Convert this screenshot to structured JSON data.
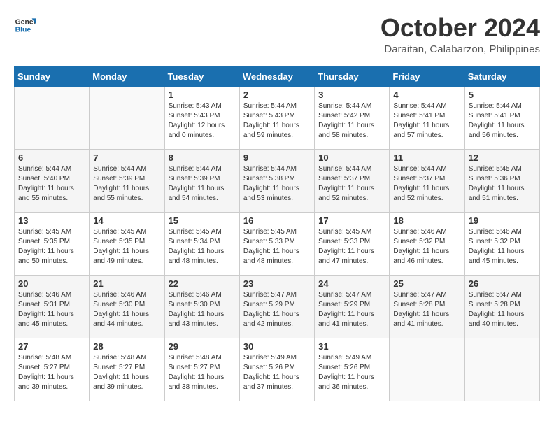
{
  "header": {
    "logo_line1": "General",
    "logo_line2": "Blue",
    "month_title": "October 2024",
    "location": "Daraitan, Calabarzon, Philippines"
  },
  "days_of_week": [
    "Sunday",
    "Monday",
    "Tuesday",
    "Wednesday",
    "Thursday",
    "Friday",
    "Saturday"
  ],
  "weeks": [
    [
      {
        "day": "",
        "info": ""
      },
      {
        "day": "",
        "info": ""
      },
      {
        "day": "1",
        "info": "Sunrise: 5:43 AM\nSunset: 5:43 PM\nDaylight: 12 hours\nand 0 minutes."
      },
      {
        "day": "2",
        "info": "Sunrise: 5:44 AM\nSunset: 5:43 PM\nDaylight: 11 hours\nand 59 minutes."
      },
      {
        "day": "3",
        "info": "Sunrise: 5:44 AM\nSunset: 5:42 PM\nDaylight: 11 hours\nand 58 minutes."
      },
      {
        "day": "4",
        "info": "Sunrise: 5:44 AM\nSunset: 5:41 PM\nDaylight: 11 hours\nand 57 minutes."
      },
      {
        "day": "5",
        "info": "Sunrise: 5:44 AM\nSunset: 5:41 PM\nDaylight: 11 hours\nand 56 minutes."
      }
    ],
    [
      {
        "day": "6",
        "info": "Sunrise: 5:44 AM\nSunset: 5:40 PM\nDaylight: 11 hours\nand 55 minutes."
      },
      {
        "day": "7",
        "info": "Sunrise: 5:44 AM\nSunset: 5:39 PM\nDaylight: 11 hours\nand 55 minutes."
      },
      {
        "day": "8",
        "info": "Sunrise: 5:44 AM\nSunset: 5:39 PM\nDaylight: 11 hours\nand 54 minutes."
      },
      {
        "day": "9",
        "info": "Sunrise: 5:44 AM\nSunset: 5:38 PM\nDaylight: 11 hours\nand 53 minutes."
      },
      {
        "day": "10",
        "info": "Sunrise: 5:44 AM\nSunset: 5:37 PM\nDaylight: 11 hours\nand 52 minutes."
      },
      {
        "day": "11",
        "info": "Sunrise: 5:44 AM\nSunset: 5:37 PM\nDaylight: 11 hours\nand 52 minutes."
      },
      {
        "day": "12",
        "info": "Sunrise: 5:45 AM\nSunset: 5:36 PM\nDaylight: 11 hours\nand 51 minutes."
      }
    ],
    [
      {
        "day": "13",
        "info": "Sunrise: 5:45 AM\nSunset: 5:35 PM\nDaylight: 11 hours\nand 50 minutes."
      },
      {
        "day": "14",
        "info": "Sunrise: 5:45 AM\nSunset: 5:35 PM\nDaylight: 11 hours\nand 49 minutes."
      },
      {
        "day": "15",
        "info": "Sunrise: 5:45 AM\nSunset: 5:34 PM\nDaylight: 11 hours\nand 48 minutes."
      },
      {
        "day": "16",
        "info": "Sunrise: 5:45 AM\nSunset: 5:33 PM\nDaylight: 11 hours\nand 48 minutes."
      },
      {
        "day": "17",
        "info": "Sunrise: 5:45 AM\nSunset: 5:33 PM\nDaylight: 11 hours\nand 47 minutes."
      },
      {
        "day": "18",
        "info": "Sunrise: 5:46 AM\nSunset: 5:32 PM\nDaylight: 11 hours\nand 46 minutes."
      },
      {
        "day": "19",
        "info": "Sunrise: 5:46 AM\nSunset: 5:32 PM\nDaylight: 11 hours\nand 45 minutes."
      }
    ],
    [
      {
        "day": "20",
        "info": "Sunrise: 5:46 AM\nSunset: 5:31 PM\nDaylight: 11 hours\nand 45 minutes."
      },
      {
        "day": "21",
        "info": "Sunrise: 5:46 AM\nSunset: 5:30 PM\nDaylight: 11 hours\nand 44 minutes."
      },
      {
        "day": "22",
        "info": "Sunrise: 5:46 AM\nSunset: 5:30 PM\nDaylight: 11 hours\nand 43 minutes."
      },
      {
        "day": "23",
        "info": "Sunrise: 5:47 AM\nSunset: 5:29 PM\nDaylight: 11 hours\nand 42 minutes."
      },
      {
        "day": "24",
        "info": "Sunrise: 5:47 AM\nSunset: 5:29 PM\nDaylight: 11 hours\nand 41 minutes."
      },
      {
        "day": "25",
        "info": "Sunrise: 5:47 AM\nSunset: 5:28 PM\nDaylight: 11 hours\nand 41 minutes."
      },
      {
        "day": "26",
        "info": "Sunrise: 5:47 AM\nSunset: 5:28 PM\nDaylight: 11 hours\nand 40 minutes."
      }
    ],
    [
      {
        "day": "27",
        "info": "Sunrise: 5:48 AM\nSunset: 5:27 PM\nDaylight: 11 hours\nand 39 minutes."
      },
      {
        "day": "28",
        "info": "Sunrise: 5:48 AM\nSunset: 5:27 PM\nDaylight: 11 hours\nand 39 minutes."
      },
      {
        "day": "29",
        "info": "Sunrise: 5:48 AM\nSunset: 5:27 PM\nDaylight: 11 hours\nand 38 minutes."
      },
      {
        "day": "30",
        "info": "Sunrise: 5:49 AM\nSunset: 5:26 PM\nDaylight: 11 hours\nand 37 minutes."
      },
      {
        "day": "31",
        "info": "Sunrise: 5:49 AM\nSunset: 5:26 PM\nDaylight: 11 hours\nand 36 minutes."
      },
      {
        "day": "",
        "info": ""
      },
      {
        "day": "",
        "info": ""
      }
    ]
  ]
}
